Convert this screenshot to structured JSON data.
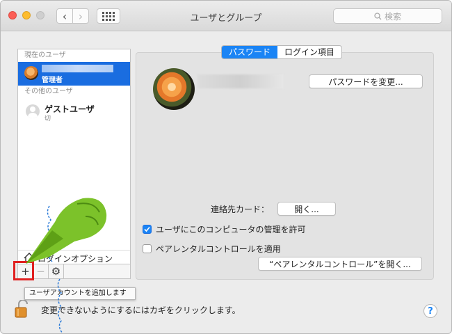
{
  "window": {
    "title": "ユーザとグループ"
  },
  "toolbar": {
    "search_placeholder": "検索",
    "back_icon": "chevron-left-icon",
    "forward_icon": "chevron-right-icon"
  },
  "sidebar": {
    "current_header": "現在のユーザ",
    "current_user": {
      "role": "管理者"
    },
    "other_header": "その他のユーザ",
    "guest": {
      "name": "ゲストユーザ",
      "status": "切"
    },
    "login_options": "ログインオプション",
    "add_label": "+",
    "remove_label": "−",
    "gear_label": "⚙"
  },
  "tooltip": "ユーザアカウントを追加します",
  "tabs": [
    {
      "label": "パスワード",
      "active": true
    },
    {
      "label": "ログイン項目",
      "active": false
    }
  ],
  "main": {
    "change_password": "パスワードを変更...",
    "contact_label": "連絡先カード：",
    "open_button": "開く...",
    "allow_admin": {
      "label": "ユーザにこのコンピュータの管理を許可",
      "checked": true
    },
    "parental": {
      "label": "ペアレンタルコントロールを適用",
      "checked": false
    },
    "open_parental": "“ペアレンタルコントロール”を開く..."
  },
  "footer": {
    "lock_text": "変更できないようにするにはカギをクリックします。",
    "help": "?"
  },
  "colors": {
    "accent": "#1a84f5",
    "selection": "#1a6de0",
    "highlight": "#e02020",
    "pointer": "#7cc22a"
  }
}
